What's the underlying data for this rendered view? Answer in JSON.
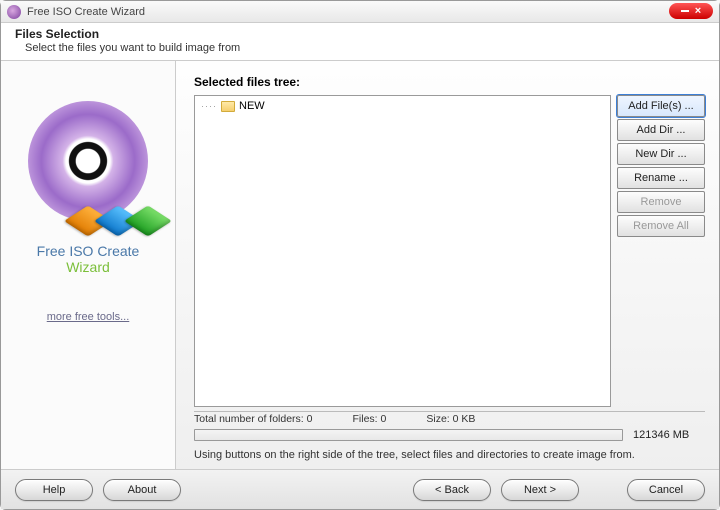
{
  "window": {
    "title": "Free ISO Create Wizard"
  },
  "header": {
    "title": "Files Selection",
    "subtitle": "Select the files you want to build image from"
  },
  "brand": {
    "line1": "Free ISO Create",
    "line2": "Wizard",
    "more_link": "more free tools..."
  },
  "main": {
    "tree_label": "Selected files tree:",
    "tree_items": [
      {
        "name": "NEW"
      }
    ],
    "side_buttons": {
      "add_files": "Add File(s) ...",
      "add_dir": "Add Dir ...",
      "new_dir": "New Dir ...",
      "rename": "Rename ...",
      "remove": "Remove",
      "remove_all": "Remove All"
    },
    "stats": {
      "folders_label": "Total number of folders:",
      "folders_value": "0",
      "files_label": "Files:",
      "files_value": "0",
      "size_label": "Size:",
      "size_value": "0 KB"
    },
    "capacity": "121346 MB",
    "hint": "Using buttons on the right side of the tree, select files and directories to create image from."
  },
  "footer": {
    "help": "Help",
    "about": "About",
    "back": "< Back",
    "next": "Next >",
    "cancel": "Cancel"
  }
}
